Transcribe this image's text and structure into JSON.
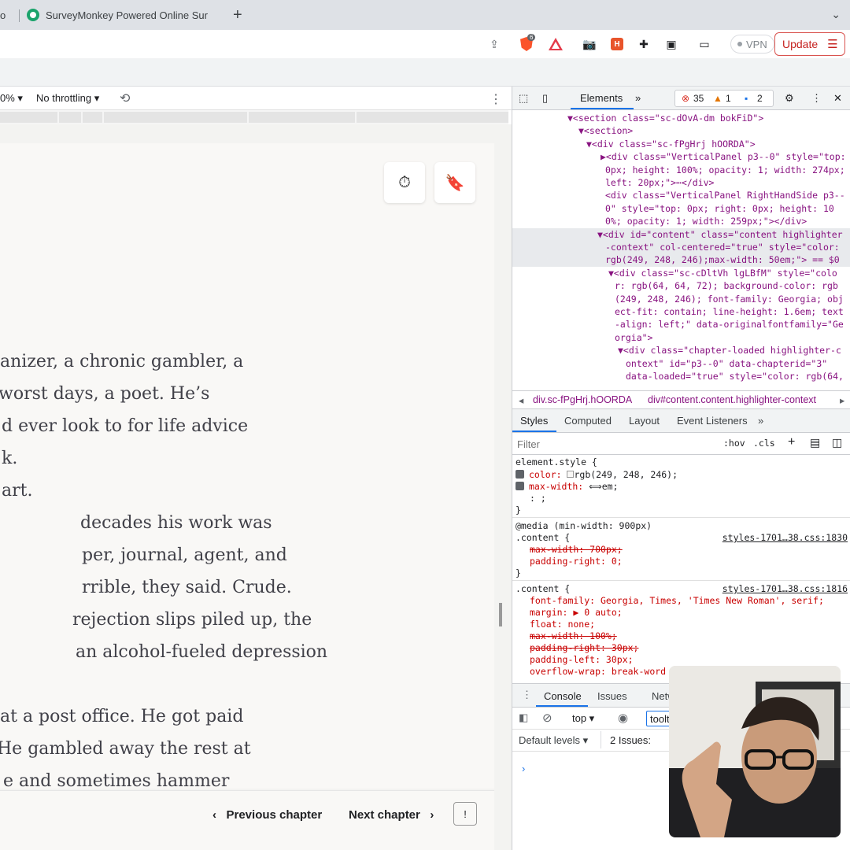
{
  "browser": {
    "tab_left_fragment": "o",
    "active_tab_title": "SurveyMonkey Powered Online Sur",
    "new_tab": "+",
    "vpn_label": "VPN",
    "update_label": "Update",
    "brave_badge": "6"
  },
  "device_toolbar": {
    "zoom": "0% ▾",
    "throttling": "No throttling ▾"
  },
  "reader": {
    "lines": [
      "anizer, a chronic gambler, a",
      "worst days, a poet. He’s",
      "d ever look to for life advice",
      "k.",
      "art.",
      "decades his work was",
      "per, journal, agent, and",
      "rrible, they said. Crude.",
      "rejection slips piled up, the",
      "an alcohol-fueled depression",
      "",
      "at a post office. He got paid",
      "He gambled away the rest at",
      "e and sometimes hammer"
    ],
    "prev_chapter": "Previous chapter",
    "next_chapter": "Next chapter"
  },
  "devtools": {
    "tab_elements": "Elements",
    "errors": "35",
    "warnings": "1",
    "messages": "2",
    "elements_lines": [
      "▼<section class=\"sc-dOvA-dm bokFiD\">",
      "▼<section>",
      "▼<div class=\"sc-fPgHrj hOORDA\">",
      "▶<div class=\"VerticalPanel p3--0\" style=\"top:",
      "0px; height: 100%; opacity: 1; width: 274px;",
      "left: 20px;\">⋯</div>",
      "<div class=\"VerticalPanel RightHandSide p3--",
      "0\" style=\"top: 0px; right: 0px; height: 10",
      "0%; opacity: 1; width: 259px;\"></div>",
      "▼<div id=\"content\" class=\"content highlighter",
      "-context\" col-centered=\"true\" style=\"color:",
      "rgb(249, 248, 246);max-width: 50em;\"> == $0",
      "▼<div class=\"sc-cDltVh lgLBfM\" style=\"colo",
      "r: rgb(64, 64, 72); background-color: rgb",
      "(249, 248, 246); font-family: Georgia; obj",
      "ect-fit: contain; line-height: 1.6em; text",
      "-align: left;\" data-originalfontfamily=\"Ge",
      "orgia\">",
      "▼<div class=\"chapter-loaded highlighter-c",
      "ontext\" id=\"p3--0\" data-chapterid=\"3\"",
      "data-loaded=\"true\" style=\"color: rgb(64,"
    ],
    "breadcrumb_1": "div.sc-fPgHrj.hOORDA",
    "breadcrumb_2": "div#content.content.highlighter-context",
    "style_tabs": [
      "Styles",
      "Computed",
      "Layout",
      "Event Listeners"
    ],
    "filter_placeholder": "Filter",
    "hov": ":hov",
    "cls": ".cls",
    "styles": {
      "element_style": "element.style {",
      "color_prop": "color:",
      "color_val": "rgb(249, 248, 246);",
      "maxw_prop": "max-width:",
      "maxw_val": "em;",
      "blank": ": ;",
      "close": "}",
      "media": "@media (min-width: 900px)",
      "content_sel": ".content {",
      "link1": "styles-1701…38.css:1830",
      "r1": "max-width: 700px;",
      "r2": "padding-right: 0;",
      "link2": "styles-1701…38.css:1816",
      "font_family": "font-family: Georgia, Times, 'Times New Roman', serif;",
      "margin": "margin: ▶ 0 auto;",
      "float": "float: none;",
      "maxw100": "max-width: 100%;",
      "pr30": "padding-right: 30px;",
      "pl30": "padding-left: 30px;",
      "ow": "overflow-wrap: break-word"
    },
    "console": {
      "tab_console": "Console",
      "tab_issues": "Issues",
      "tab_network": "Netw",
      "context": "top ▾",
      "filter_value": "toolt",
      "levels": "Default levels ▾",
      "issues_count": "2 Issues:"
    }
  }
}
